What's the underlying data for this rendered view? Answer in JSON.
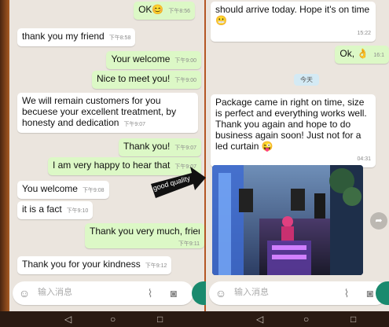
{
  "left_chat": {
    "messages": [
      {
        "dir": "out",
        "text": "OK😊",
        "time": "下午8:56"
      },
      {
        "dir": "in",
        "text": "thank you my friend",
        "time": "下午8:58"
      },
      {
        "dir": "out",
        "text": "Your welcome",
        "time": "下午9:00"
      },
      {
        "dir": "out",
        "text": "Nice to meet you!",
        "time": "下午9:00"
      },
      {
        "dir": "in",
        "text": "We will remain customers for you becuese your excellent treatment, by honesty and dedication",
        "time": "下午9:07"
      },
      {
        "dir": "out",
        "text": "Thank you!",
        "time": "下午9:07"
      },
      {
        "dir": "out",
        "text": "I am very happy to hear that",
        "time": "下午9:07"
      },
      {
        "dir": "in",
        "text": "You welcome",
        "time": "下午9:08"
      },
      {
        "dir": "in",
        "text": "it is a fact",
        "time": "下午9:10"
      },
      {
        "dir": "out",
        "text": "Thank you very much, frien",
        "time": "下午9:11"
      },
      {
        "dir": "in",
        "text": "Thank you for your kindness",
        "time": "下午9:12"
      }
    ],
    "input_placeholder": "输入消息"
  },
  "right_chat": {
    "messages": [
      {
        "dir": "in",
        "text": "should arrive today. Hope it's on time 😬",
        "time": "15:22"
      },
      {
        "dir": "out",
        "text": "Ok, 👌",
        "time": "16:1"
      },
      {
        "dir": "in",
        "text": "Package came in right on time, size is perfect and everything works well. Thank you again and hope to do business again soon! Just not for a led curtain 😜",
        "time": "04:31"
      }
    ],
    "date_chip": "今天",
    "input_placeholder": "输入消息"
  },
  "overlay_label": "good quality",
  "icons": {
    "emoji": "smile-icon",
    "attach": "paperclip-icon",
    "camera": "camera-icon",
    "forward": "forward-icon",
    "nav_back": "back-icon",
    "nav_home": "home-icon",
    "nav_recent": "recent-apps-icon"
  },
  "colors": {
    "incoming": "#ffffff",
    "outgoing": "#dcf8c6",
    "chat_bg": "#ebe5de",
    "send": "#1a8a6e"
  }
}
